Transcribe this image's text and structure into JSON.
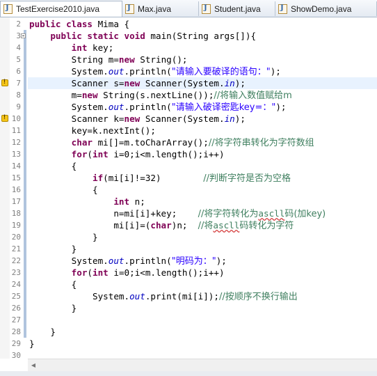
{
  "tabs": [
    {
      "label": "TestExercise2010.java",
      "active": true
    },
    {
      "label": "Max.java",
      "active": false
    },
    {
      "label": "Student.java",
      "active": false
    },
    {
      "label": "ShowDemo.java",
      "active": false
    }
  ],
  "current_line": 7,
  "warning_lines": [
    7,
    10
  ],
  "fold_lines": [
    3
  ],
  "changed_lines": [
    3,
    4,
    5,
    6,
    7,
    8,
    9,
    10,
    11,
    12,
    13,
    14,
    15,
    16,
    17,
    18,
    19,
    20,
    21,
    22,
    23,
    24,
    25,
    26,
    27,
    28
  ],
  "code_lines": [
    {
      "n": "2",
      "segs": [
        [
          "kw",
          "public class "
        ],
        [
          "",
          "Mima {"
        ]
      ]
    },
    {
      "n": "3",
      "segs": [
        [
          "",
          "    "
        ],
        [
          "kw",
          "public static void "
        ],
        [
          "",
          "main(String args[]){"
        ]
      ]
    },
    {
      "n": "4",
      "segs": [
        [
          "",
          "        "
        ],
        [
          "kw",
          "int "
        ],
        [
          "",
          "key;"
        ]
      ]
    },
    {
      "n": "5",
      "segs": [
        [
          "",
          "        String m="
        ],
        [
          "kw",
          "new "
        ],
        [
          "",
          "String();"
        ]
      ]
    },
    {
      "n": "6",
      "segs": [
        [
          "",
          "        System."
        ],
        [
          "fld",
          "out"
        ],
        [
          "",
          ".println("
        ],
        [
          "str",
          "\"请输入要破译的语句：\""
        ],
        [
          "",
          ");"
        ]
      ]
    },
    {
      "n": "7",
      "segs": [
        [
          "",
          "        Scanner s="
        ],
        [
          "kw",
          "new "
        ],
        [
          "",
          "Scanner(System."
        ],
        [
          "fld",
          "in"
        ],
        [
          "",
          ");"
        ]
      ]
    },
    {
      "n": "8",
      "segs": [
        [
          "",
          "        m="
        ],
        [
          "kw",
          "new "
        ],
        [
          "",
          "String(s.nextLine());"
        ],
        [
          "cm",
          "//将输入数值赋给m"
        ]
      ]
    },
    {
      "n": "9",
      "segs": [
        [
          "",
          "        System."
        ],
        [
          "fld",
          "out"
        ],
        [
          "",
          ".println("
        ],
        [
          "str",
          "\"请输入破译密匙key=：\""
        ],
        [
          "",
          ");"
        ]
      ]
    },
    {
      "n": "10",
      "segs": [
        [
          "",
          "        Scanner k="
        ],
        [
          "kw",
          "new "
        ],
        [
          "",
          "Scanner(System."
        ],
        [
          "fld",
          "in"
        ],
        [
          "",
          ");"
        ]
      ]
    },
    {
      "n": "11",
      "segs": [
        [
          "",
          "        key=k.nextInt();"
        ]
      ]
    },
    {
      "n": "12",
      "segs": [
        [
          "",
          "        "
        ],
        [
          "kw",
          "char "
        ],
        [
          "",
          "mi[]=m.toCharArray();"
        ],
        [
          "cm",
          "//将字符串转化为字符数组"
        ]
      ]
    },
    {
      "n": "13",
      "segs": [
        [
          "",
          "        "
        ],
        [
          "kw",
          "for"
        ],
        [
          "",
          "("
        ],
        [
          "kw",
          "int "
        ],
        [
          "",
          "i=0;i<m.length();i++)"
        ]
      ]
    },
    {
      "n": "14",
      "segs": [
        [
          "",
          "        {"
        ]
      ]
    },
    {
      "n": "15",
      "segs": [
        [
          "",
          "            "
        ],
        [
          "kw",
          "if"
        ],
        [
          "",
          "(mi[i]!=32)        "
        ],
        [
          "cm",
          "//判断字符是否为空格"
        ]
      ]
    },
    {
      "n": "16",
      "segs": [
        [
          "",
          "            {"
        ]
      ]
    },
    {
      "n": "17",
      "segs": [
        [
          "",
          "                "
        ],
        [
          "kw",
          "int "
        ],
        [
          "",
          "n;"
        ]
      ]
    },
    {
      "n": "18",
      "segs": [
        [
          "",
          "                n=mi[i]+key;    "
        ],
        [
          "cm",
          "//将字符转化为"
        ],
        [
          "cm squig",
          "ascll"
        ],
        [
          "cm",
          "码(加key)"
        ]
      ]
    },
    {
      "n": "19",
      "segs": [
        [
          "",
          "                mi[i]=("
        ],
        [
          "kw",
          "char"
        ],
        [
          "",
          ")n;  "
        ],
        [
          "cm",
          "//将"
        ],
        [
          "cm squig",
          "ascll"
        ],
        [
          "cm",
          "码转化为字符"
        ]
      ]
    },
    {
      "n": "20",
      "segs": [
        [
          "",
          "            }"
        ]
      ]
    },
    {
      "n": "21",
      "segs": [
        [
          "",
          "        }"
        ]
      ]
    },
    {
      "n": "22",
      "segs": [
        [
          "",
          "        System."
        ],
        [
          "fld",
          "out"
        ],
        [
          "",
          ".println("
        ],
        [
          "str",
          "\"明码为：\""
        ],
        [
          "",
          ");"
        ]
      ]
    },
    {
      "n": "23",
      "segs": [
        [
          "",
          "        "
        ],
        [
          "kw",
          "for"
        ],
        [
          "",
          "("
        ],
        [
          "kw",
          "int "
        ],
        [
          "",
          "i=0;i<m.length();i++)"
        ]
      ]
    },
    {
      "n": "24",
      "segs": [
        [
          "",
          "        {"
        ]
      ]
    },
    {
      "n": "25",
      "segs": [
        [
          "",
          "            System."
        ],
        [
          "fld",
          "out"
        ],
        [
          "",
          ".print(mi[i]);"
        ],
        [
          "cm",
          "//按顺序不换行输出"
        ]
      ]
    },
    {
      "n": "26",
      "segs": [
        [
          "",
          "        }"
        ]
      ]
    },
    {
      "n": "27",
      "segs": [
        [
          "",
          ""
        ]
      ]
    },
    {
      "n": "28",
      "segs": [
        [
          "",
          "    }"
        ]
      ]
    },
    {
      "n": "29",
      "segs": [
        [
          "",
          "}"
        ]
      ]
    },
    {
      "n": "30",
      "segs": [
        [
          "",
          ""
        ]
      ]
    }
  ],
  "scroll_left_label": "◀"
}
